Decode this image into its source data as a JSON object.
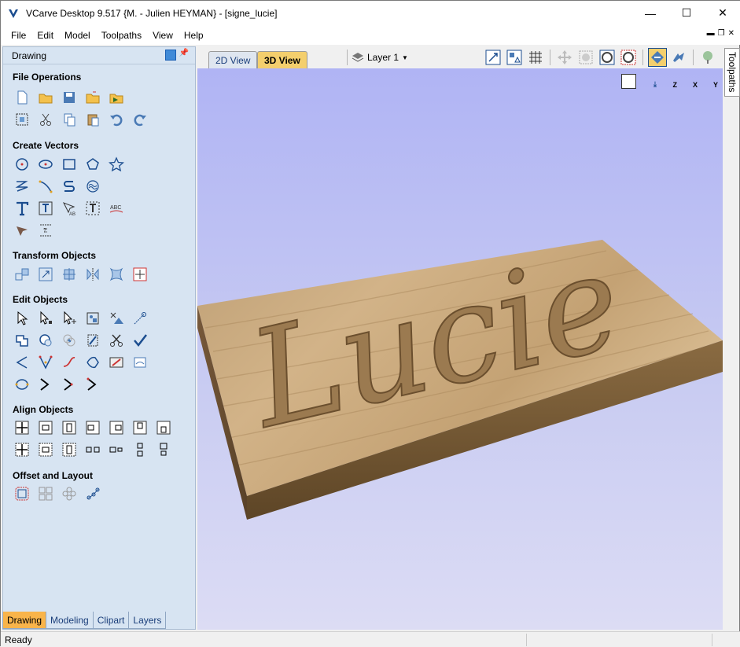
{
  "window": {
    "title": "VCarve Desktop 9.517 {M. - Julien HEYMAN} - [signe_lucie]",
    "controls": {
      "minimize": "—",
      "maximize": "☐",
      "close": "✕"
    }
  },
  "menu": [
    "File",
    "Edit",
    "Model",
    "Toolpaths",
    "View",
    "Help"
  ],
  "left_panel": {
    "header": "Drawing",
    "sections": {
      "file_operations": "File Operations",
      "create_vectors": "Create Vectors",
      "transform_objects": "Transform Objects",
      "edit_objects": "Edit Objects",
      "align_objects": "Align Objects",
      "offset_layout": "Offset and Layout"
    },
    "bottom_tabs": [
      "Drawing",
      "Modeling",
      "Clipart",
      "Layers"
    ],
    "active_tab": "Drawing"
  },
  "view_toolbar": {
    "tab_2d": "2D View",
    "tab_3d": "3D View",
    "active_tab": "3D View",
    "layer": "Layer 1"
  },
  "view_axis_icons": [
    "Z",
    "X",
    "Y"
  ],
  "model_text": "Lucie",
  "right_tab": "Toolpaths",
  "status": "Ready",
  "colors": {
    "panel_bg": "#d7e4f2",
    "active_tab": "#f9b44a",
    "view_top": "#b0b4f4",
    "view_bottom": "#dcdcf4",
    "wood": "#c8a77a"
  }
}
